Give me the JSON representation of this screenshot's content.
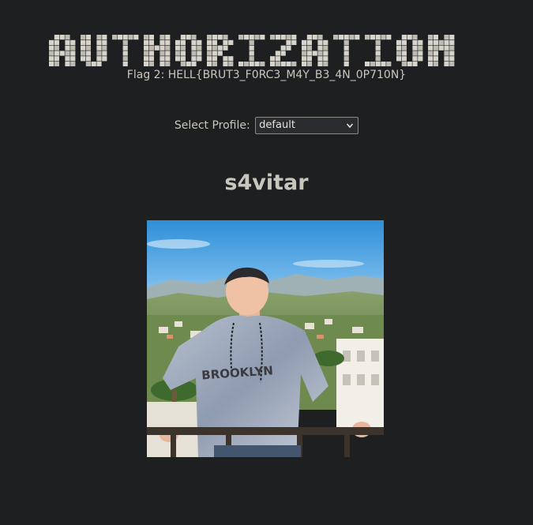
{
  "header": {
    "title_art_text": "AUTHORIZATION",
    "flag_text": "Flag 2: HELL{BRUT3_F0RC3_M4Y_B3_4N_0P710N}"
  },
  "profile": {
    "label": "Select Profile:",
    "selected": "default"
  },
  "user": {
    "name": "s4vitar"
  },
  "photo": {
    "shirt_text": "BROOKLYN"
  }
}
